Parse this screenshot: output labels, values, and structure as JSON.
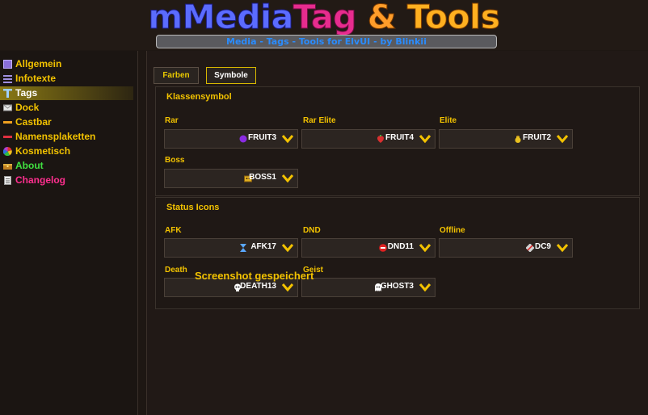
{
  "header": {
    "logo_part1": "mMedia",
    "logo_part2": "Tag",
    "logo_amp": " & ",
    "logo_part3": "Tools",
    "subtitle": "Media - Tags - Tools for ElvUI - by Blinkii"
  },
  "sidebar": {
    "items": [
      {
        "label": "Allgemein",
        "icon": "gear-square-icon"
      },
      {
        "label": "Infotexte",
        "icon": "lines-icon"
      },
      {
        "label": "Tags",
        "icon": "text-t-icon"
      },
      {
        "label": "Dock",
        "icon": "envelope-icon"
      },
      {
        "label": "Castbar",
        "icon": "castbar-icon"
      },
      {
        "label": "Namensplaketten",
        "icon": "nameplate-bar-icon"
      },
      {
        "label": "Kosmetisch",
        "icon": "color-wheel-icon"
      },
      {
        "label": "About",
        "icon": "treasure-chest-icon"
      },
      {
        "label": "Changelog",
        "icon": "notepad-icon"
      }
    ],
    "active_index": 2
  },
  "tabs": [
    {
      "label": "Farben"
    },
    {
      "label": "Symbole"
    }
  ],
  "active_tab": "Symbole",
  "groups": {
    "klassensymbol": {
      "title": "Klassensymbol",
      "fields": [
        {
          "label": "Rar",
          "value": "FRUIT3",
          "icon": "grape-icon",
          "icon_color": "#8a2be2"
        },
        {
          "label": "Rar Elite",
          "value": "FRUIT4",
          "icon": "strawberry-icon",
          "icon_color": "#d83030"
        },
        {
          "label": "Elite",
          "value": "FRUIT2",
          "icon": "pear-icon",
          "icon_color": "#e8c020"
        },
        {
          "label": "Boss",
          "value": "BOSS1",
          "icon": "boss-crown-icon",
          "icon_color": "#e0b020"
        }
      ]
    },
    "status_icons": {
      "title": "Status Icons",
      "fields": [
        {
          "label": "AFK",
          "value": "AFK17",
          "icon": "hourglass-icon",
          "icon_color": "#5aa8ff"
        },
        {
          "label": "DND",
          "value": "DND11",
          "icon": "no-entry-icon",
          "icon_color": "#e02020"
        },
        {
          "label": "Offline",
          "value": "DC9",
          "icon": "unplugged-icon",
          "icon_color": "#e0e0e0"
        },
        {
          "label": "Death",
          "value": "DEATH13",
          "icon": "skull-icon",
          "icon_color": "#ffffff"
        },
        {
          "label": "Geist",
          "value": "GHOST3",
          "icon": "ghost-icon",
          "icon_color": "#ffffff"
        }
      ]
    }
  },
  "toast": "Screenshot gespeichert",
  "colors": {
    "accent": "#f2c200",
    "background": "#1e1713"
  }
}
